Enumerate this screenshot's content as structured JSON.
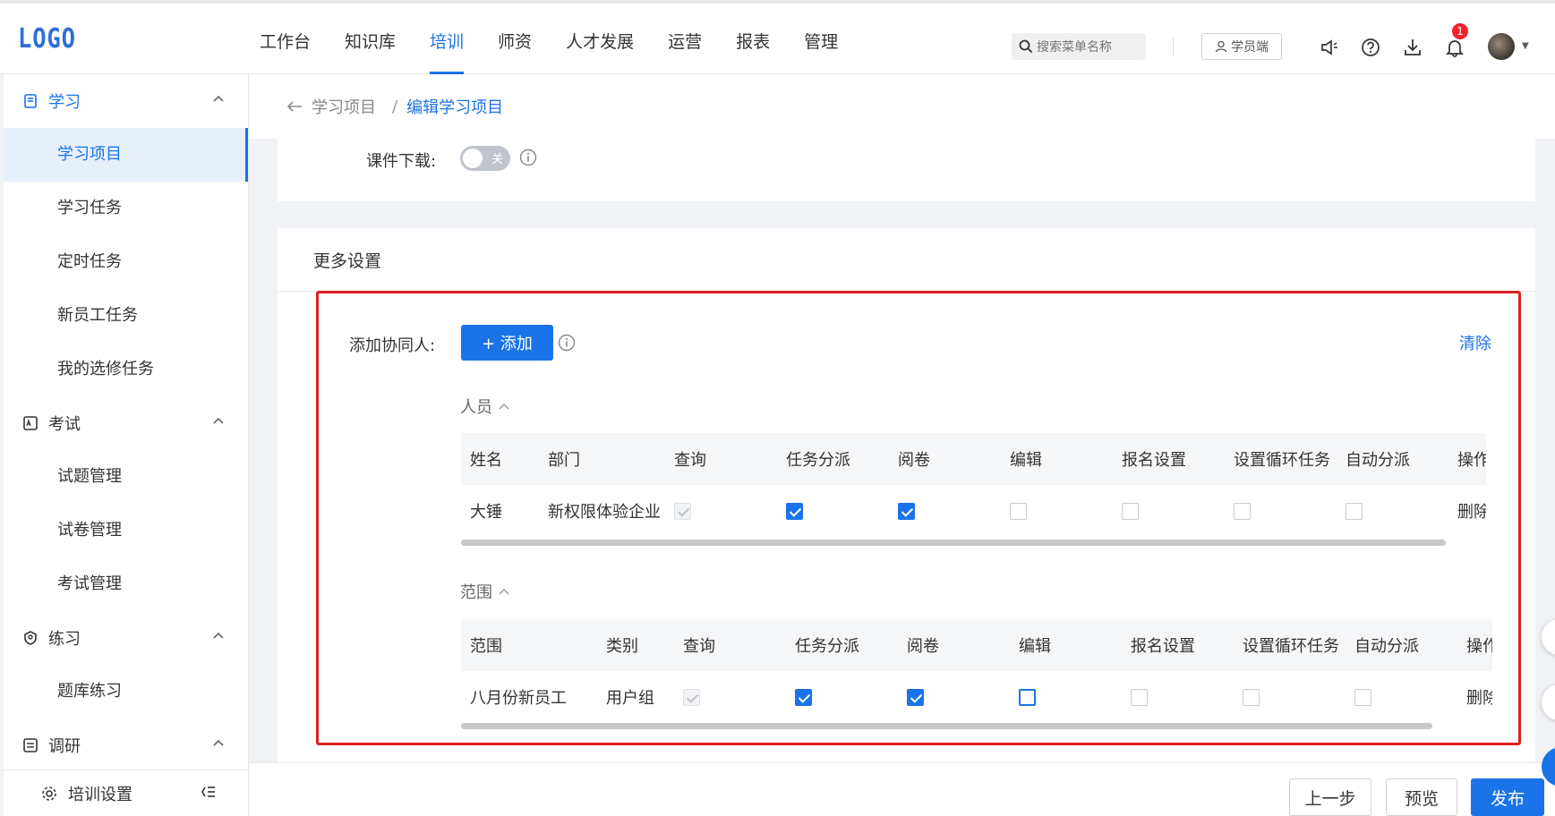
{
  "header": {
    "logo": "LOGO",
    "nav": [
      "工作台",
      "知识库",
      "培训",
      "师资",
      "人才发展",
      "运营",
      "报表",
      "管理"
    ],
    "active_nav": "培训",
    "search_placeholder": "搜索菜单名称",
    "student_label": "学员端",
    "notification_count": "1"
  },
  "sidebar": {
    "groups": [
      {
        "label": "学习",
        "items": [
          "学习项目",
          "学习任务",
          "定时任务",
          "新员工任务",
          "我的选修任务"
        ]
      },
      {
        "label": "考试",
        "items": [
          "试题管理",
          "试卷管理",
          "考试管理"
        ]
      },
      {
        "label": "练习",
        "items": [
          "题库练习"
        ]
      },
      {
        "label": "调研",
        "items": []
      }
    ],
    "active_item": "学习项目",
    "footer_label": "培训设置"
  },
  "breadcrumb": {
    "prev": "学习项目",
    "separator": "/",
    "current": "编辑学习项目"
  },
  "courseware": {
    "label": "课件下载:",
    "toggle_text": "关"
  },
  "more_settings": {
    "title": "更多设置",
    "collab_label": "添加协同人:",
    "add_button": "+ 添加",
    "clear_link": "清除",
    "people_section": "人员",
    "people_table": {
      "headers": [
        "姓名",
        "部门",
        "查询",
        "任务分派",
        "阅卷",
        "编辑",
        "报名设置",
        "设置循环任务",
        "自动分派",
        "操作"
      ],
      "rows": [
        {
          "name": "大锤",
          "dept": "新权限体验企业",
          "query": "disabled",
          "assign": "checked",
          "grade": "checked",
          "edit": "unchecked",
          "signup": "unchecked",
          "cycle": "unchecked",
          "auto": "unchecked",
          "action": "删除"
        }
      ]
    },
    "scope_section": "范围",
    "scope_table": {
      "headers": [
        "范围",
        "类别",
        "查询",
        "任务分派",
        "阅卷",
        "编辑",
        "报名设置",
        "设置循环任务",
        "自动分派",
        "操作"
      ],
      "rows": [
        {
          "scope": "八月份新员工",
          "type": "用户组",
          "query": "disabled",
          "assign": "checked",
          "grade": "checked",
          "edit": "focus",
          "signup": "unchecked",
          "cycle": "unchecked",
          "auto": "unchecked",
          "action": "删除"
        }
      ]
    }
  },
  "footer": {
    "prev": "上一步",
    "preview": "预览",
    "publish": "发布"
  }
}
